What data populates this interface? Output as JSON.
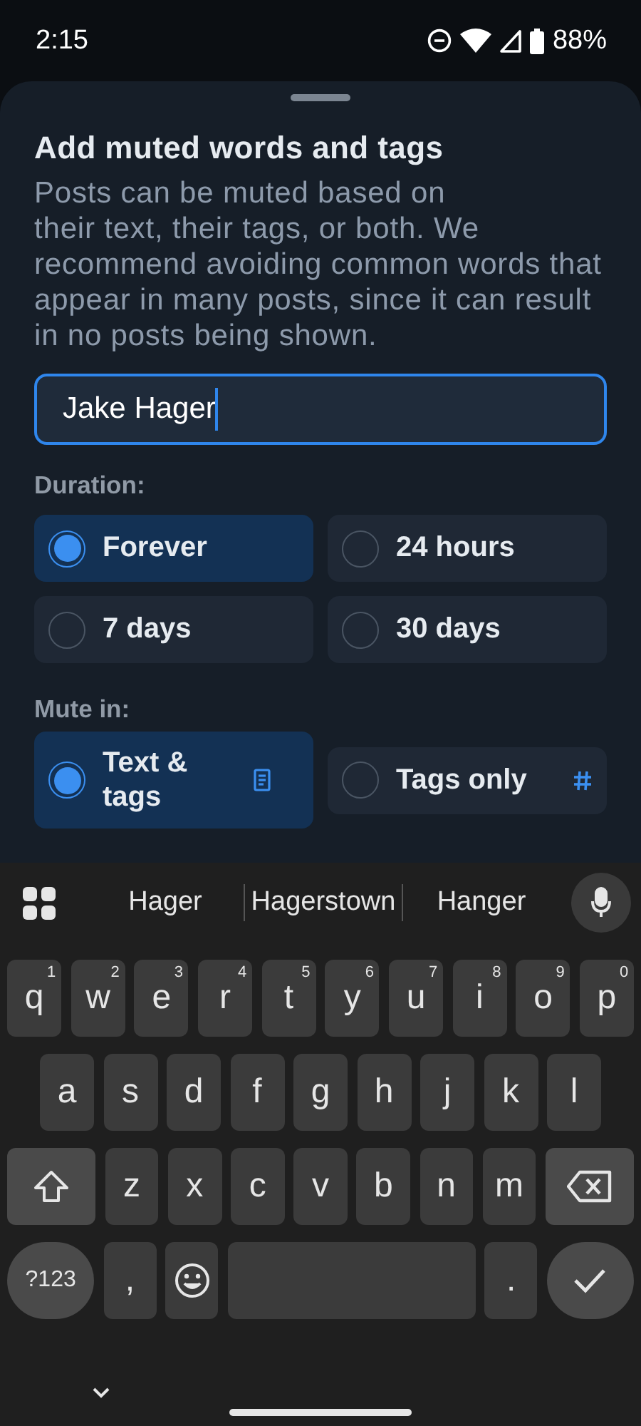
{
  "status_bar": {
    "time": "2:15",
    "battery": "88%"
  },
  "sheet": {
    "title": "Add muted words and tags",
    "description": "Posts can be muted based on\ntheir text, their tags, or both. We recommend avoiding common words that appear in many posts, since it can result in no posts being shown.",
    "input": {
      "value": "Jake Hager"
    },
    "duration": {
      "label": "Duration:",
      "options": [
        {
          "label": "Forever",
          "selected": true
        },
        {
          "label": "24 hours",
          "selected": false
        },
        {
          "label": "7 days",
          "selected": false
        },
        {
          "label": "30 days",
          "selected": false
        }
      ]
    },
    "mute_in": {
      "label": "Mute in:",
      "options": [
        {
          "label": "Text & tags",
          "kind": "text",
          "selected": true
        },
        {
          "label": "Tags only",
          "kind": "tags",
          "selected": false
        }
      ]
    }
  },
  "keyboard": {
    "suggestions": [
      "Hager",
      "Hagerstown",
      "Hanger"
    ],
    "rows": [
      {
        "keys": [
          {
            "label": "q",
            "hint": "1"
          },
          {
            "label": "w",
            "hint": "2"
          },
          {
            "label": "e",
            "hint": "3"
          },
          {
            "label": "r",
            "hint": "4"
          },
          {
            "label": "t",
            "hint": "5"
          },
          {
            "label": "y",
            "hint": "6"
          },
          {
            "label": "u",
            "hint": "7"
          },
          {
            "label": "i",
            "hint": "8"
          },
          {
            "label": "o",
            "hint": "9"
          },
          {
            "label": "p",
            "hint": "0"
          }
        ]
      },
      {
        "keys": [
          {
            "label": "a"
          },
          {
            "label": "s"
          },
          {
            "label": "d"
          },
          {
            "label": "f"
          },
          {
            "label": "g"
          },
          {
            "label": "h"
          },
          {
            "label": "j"
          },
          {
            "label": "k"
          },
          {
            "label": "l"
          }
        ]
      },
      {
        "keys": [
          {
            "kind": "shift"
          },
          {
            "label": "z"
          },
          {
            "label": "x"
          },
          {
            "label": "c"
          },
          {
            "label": "v"
          },
          {
            "label": "b"
          },
          {
            "label": "n"
          },
          {
            "label": "m"
          },
          {
            "kind": "backspace"
          }
        ]
      },
      {
        "keys": [
          {
            "kind": "symbols",
            "label": "?123"
          },
          {
            "label": ","
          },
          {
            "kind": "emoji"
          },
          {
            "kind": "space"
          },
          {
            "label": "."
          },
          {
            "kind": "enter"
          }
        ]
      }
    ]
  }
}
